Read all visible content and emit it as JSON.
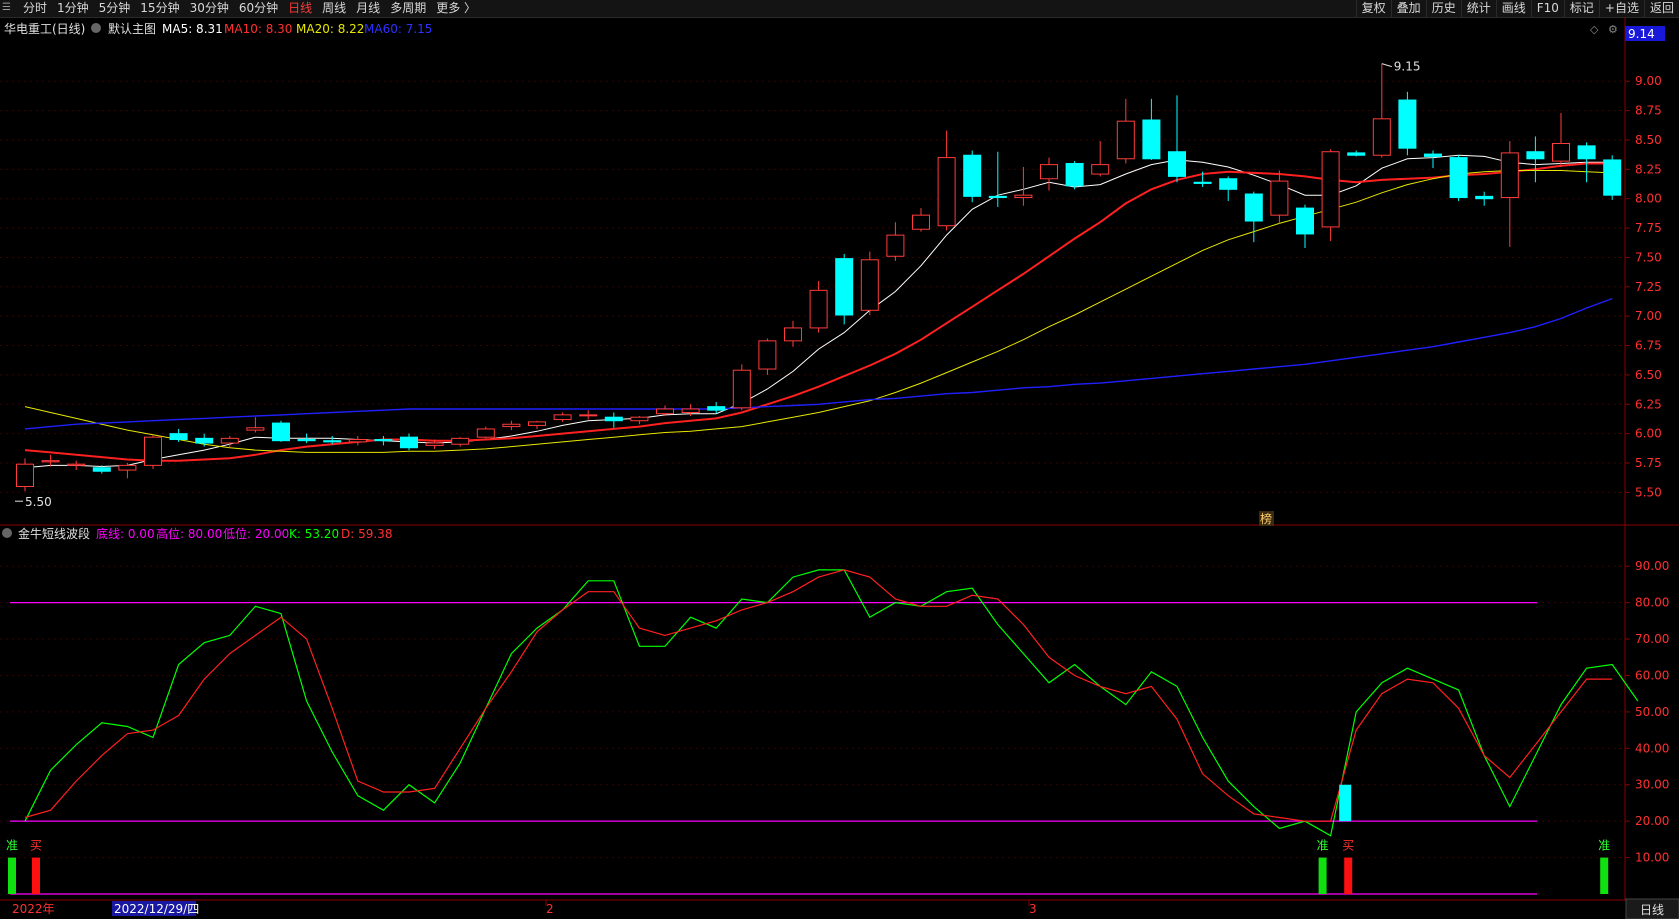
{
  "toolbar": {
    "left": [
      "分时",
      "1分钟",
      "5分钟",
      "15分钟",
      "30分钟",
      "60分钟",
      "日线",
      "周线",
      "月线",
      "多周期",
      "更多 〉"
    ],
    "active": "日线",
    "right": [
      "复权",
      "叠加",
      "历史",
      "统计",
      "画线",
      "F10",
      "标记",
      "+自选",
      "返回"
    ]
  },
  "main_header": {
    "stock": "华电重工(日线)",
    "template": "默认主图",
    "ma5": "MA5: 8.31",
    "ma10": "MA10: 8.30",
    "ma20": "MA20: 8.22",
    "ma60": "MA60: 7.15",
    "current_price_tag": "9.14",
    "high_label": "9.15",
    "low_label": "5.50",
    "badge": "榜"
  },
  "indicator_header": {
    "name": "金牛短线波段",
    "bottom": "底线: 0.00",
    "high": "高位: 80.00",
    "low": "低位: 20.00",
    "k": "K: 53.20",
    "d": "D: 59.38"
  },
  "signals": [
    "准",
    "买",
    "准",
    "买",
    "准"
  ],
  "xaxis": [
    "2022年",
    "2022/12/29/四",
    "2",
    "3"
  ],
  "period_tab": "日线",
  "colors": {
    "up": "#ff3b3b",
    "down": "#00ffff",
    "ma5": "#ffffff",
    "ma10": "#ff2020",
    "ma20": "#e8e800",
    "ma60": "#2020ff",
    "k": "#00ff00",
    "d": "#ff2020",
    "guide": "#ff00ff"
  },
  "chart_data": [
    {
      "type": "candlestick",
      "ylim": [
        5.35,
        9.3
      ],
      "yticks": [
        5.5,
        5.75,
        6.0,
        6.25,
        6.5,
        6.75,
        7.0,
        7.25,
        7.5,
        7.75,
        8.0,
        8.25,
        8.5,
        8.75,
        9.0
      ],
      "series": [
        {
          "name": "K线",
          "ohlc": [
            [
              5.55,
              5.79,
              5.51,
              5.74
            ],
            [
              5.76,
              5.82,
              5.72,
              5.77
            ],
            [
              5.73,
              5.77,
              5.69,
              5.74
            ],
            [
              5.71,
              5.73,
              5.66,
              5.68
            ],
            [
              5.69,
              5.75,
              5.62,
              5.73
            ],
            [
              5.73,
              5.99,
              5.7,
              5.97
            ],
            [
              6.0,
              6.04,
              5.93,
              5.95
            ],
            [
              5.96,
              6.0,
              5.89,
              5.92
            ],
            [
              5.92,
              5.98,
              5.88,
              5.96
            ],
            [
              6.03,
              6.14,
              6.01,
              6.05
            ],
            [
              6.09,
              6.11,
              5.93,
              5.94
            ],
            [
              5.95,
              6.0,
              5.92,
              5.94
            ],
            [
              5.94,
              5.98,
              5.91,
              5.93
            ],
            [
              5.93,
              5.98,
              5.9,
              5.95
            ],
            [
              5.95,
              5.98,
              5.9,
              5.94
            ],
            [
              5.97,
              6.0,
              5.86,
              5.88
            ],
            [
              5.9,
              5.95,
              5.87,
              5.92
            ],
            [
              5.91,
              5.97,
              5.89,
              5.96
            ],
            [
              5.97,
              6.06,
              5.96,
              6.04
            ],
            [
              6.06,
              6.11,
              6.03,
              6.08
            ],
            [
              6.07,
              6.11,
              6.04,
              6.1
            ],
            [
              6.12,
              6.18,
              6.1,
              6.16
            ],
            [
              6.16,
              6.2,
              6.12,
              6.16
            ],
            [
              6.14,
              6.18,
              6.05,
              6.11
            ],
            [
              6.11,
              6.15,
              6.08,
              6.14
            ],
            [
              6.17,
              6.24,
              6.15,
              6.21
            ],
            [
              6.18,
              6.25,
              6.15,
              6.21
            ],
            [
              6.23,
              6.27,
              6.17,
              6.2
            ],
            [
              6.22,
              6.59,
              6.2,
              6.54
            ],
            [
              6.55,
              6.81,
              6.5,
              6.79
            ],
            [
              6.79,
              6.96,
              6.74,
              6.9
            ],
            [
              6.9,
              7.3,
              6.86,
              7.22
            ],
            [
              7.49,
              7.53,
              6.93,
              7.01
            ],
            [
              7.05,
              7.55,
              7.01,
              7.48
            ],
            [
              7.51,
              7.8,
              7.47,
              7.69
            ],
            [
              7.74,
              7.92,
              7.72,
              7.86
            ],
            [
              7.77,
              8.58,
              7.73,
              8.35
            ],
            [
              8.37,
              8.41,
              7.97,
              8.02
            ],
            [
              8.02,
              8.4,
              7.93,
              8.01
            ],
            [
              8.01,
              8.27,
              7.94,
              8.03
            ],
            [
              8.17,
              8.35,
              8.07,
              8.29
            ],
            [
              8.3,
              8.32,
              8.08,
              8.11
            ],
            [
              8.21,
              8.49,
              8.19,
              8.29
            ],
            [
              8.34,
              8.85,
              8.3,
              8.66
            ],
            [
              8.67,
              8.85,
              8.33,
              8.34
            ],
            [
              8.4,
              8.88,
              8.14,
              8.19
            ],
            [
              8.14,
              8.23,
              8.1,
              8.13
            ],
            [
              8.17,
              8.19,
              7.98,
              8.08
            ],
            [
              8.04,
              8.06,
              7.63,
              7.81
            ],
            [
              7.86,
              8.24,
              7.79,
              8.15
            ],
            [
              7.92,
              7.95,
              7.58,
              7.7
            ],
            [
              7.76,
              8.42,
              7.64,
              8.4
            ],
            [
              8.39,
              8.41,
              8.36,
              8.37
            ],
            [
              8.37,
              9.15,
              8.35,
              8.68
            ],
            [
              8.84,
              8.91,
              8.37,
              8.43
            ],
            [
              8.38,
              8.41,
              8.26,
              8.36
            ],
            [
              8.35,
              8.37,
              7.98,
              8.01
            ],
            [
              8.02,
              8.06,
              7.94,
              8.0
            ],
            [
              8.01,
              8.49,
              7.59,
              8.39
            ],
            [
              8.4,
              8.53,
              8.14,
              8.34
            ],
            [
              8.32,
              8.73,
              8.27,
              8.47
            ],
            [
              8.45,
              8.48,
              8.14,
              8.34
            ],
            [
              8.33,
              8.37,
              7.99,
              8.03
            ]
          ]
        },
        {
          "name": "MA5",
          "values": [
            5.71,
            5.73,
            5.73,
            5.72,
            5.73,
            5.78,
            5.82,
            5.86,
            5.91,
            5.97,
            5.96,
            5.96,
            5.96,
            5.95,
            5.94,
            5.93,
            5.92,
            5.93,
            5.95,
            5.98,
            6.02,
            6.07,
            6.11,
            6.12,
            6.13,
            6.16,
            6.17,
            6.17,
            6.26,
            6.38,
            6.53,
            6.72,
            6.86,
            7.05,
            7.21,
            7.43,
            7.69,
            7.91,
            8.03,
            8.08,
            8.14,
            8.1,
            8.12,
            8.21,
            8.29,
            8.33,
            8.31,
            8.27,
            8.2,
            8.12,
            8.03,
            8.03,
            8.11,
            8.26,
            8.34,
            8.35,
            8.37,
            8.36,
            8.31,
            8.29,
            8.3,
            8.31,
            8.31
          ]
        },
        {
          "name": "MA10",
          "values": [
            5.86,
            5.84,
            5.82,
            5.8,
            5.78,
            5.77,
            5.77,
            5.78,
            5.79,
            5.82,
            5.86,
            5.89,
            5.91,
            5.93,
            5.95,
            5.95,
            5.94,
            5.94,
            5.95,
            5.96,
            5.98,
            6.0,
            6.02,
            6.04,
            6.06,
            6.09,
            6.11,
            6.13,
            6.18,
            6.25,
            6.32,
            6.4,
            6.49,
            6.58,
            6.68,
            6.8,
            6.94,
            7.08,
            7.22,
            7.36,
            7.51,
            7.66,
            7.8,
            7.96,
            8.08,
            8.16,
            8.21,
            8.23,
            8.22,
            8.21,
            8.19,
            8.16,
            8.14,
            8.16,
            8.17,
            8.18,
            8.2,
            8.21,
            8.23,
            8.25,
            8.28,
            8.3,
            8.3
          ]
        },
        {
          "name": "MA20",
          "values": [
            6.23,
            6.18,
            6.13,
            6.08,
            6.03,
            5.99,
            5.95,
            5.91,
            5.88,
            5.86,
            5.85,
            5.84,
            5.84,
            5.84,
            5.84,
            5.85,
            5.85,
            5.86,
            5.87,
            5.89,
            5.91,
            5.93,
            5.95,
            5.97,
            5.99,
            6.01,
            6.02,
            6.04,
            6.06,
            6.1,
            6.14,
            6.18,
            6.23,
            6.28,
            6.35,
            6.43,
            6.52,
            6.61,
            6.7,
            6.8,
            6.91,
            7.01,
            7.12,
            7.23,
            7.34,
            7.45,
            7.56,
            7.65,
            7.72,
            7.79,
            7.85,
            7.91,
            7.97,
            8.05,
            8.12,
            8.17,
            8.21,
            8.23,
            8.24,
            8.24,
            8.24,
            8.23,
            8.22
          ]
        },
        {
          "name": "MA60",
          "values": [
            6.04,
            6.06,
            6.08,
            6.09,
            6.1,
            6.11,
            6.12,
            6.13,
            6.14,
            6.15,
            6.16,
            6.17,
            6.18,
            6.19,
            6.2,
            6.21,
            6.21,
            6.21,
            6.21,
            6.21,
            6.21,
            6.21,
            6.21,
            6.21,
            6.21,
            6.21,
            6.21,
            6.21,
            6.22,
            6.23,
            6.24,
            6.25,
            6.27,
            6.29,
            6.3,
            6.32,
            6.34,
            6.35,
            6.37,
            6.39,
            6.4,
            6.42,
            6.43,
            6.45,
            6.47,
            6.49,
            6.51,
            6.53,
            6.55,
            6.57,
            6.59,
            6.62,
            6.65,
            6.68,
            6.71,
            6.74,
            6.78,
            6.82,
            6.86,
            6.91,
            6.98,
            7.07,
            7.15
          ]
        }
      ]
    },
    {
      "type": "line",
      "ylim": [
        0,
        95
      ],
      "yticks": [
        10,
        20,
        30,
        40,
        50,
        60,
        70,
        80,
        90
      ],
      "guides": [
        20,
        80,
        0
      ],
      "series": [
        {
          "name": "K",
          "values": [
            20,
            34,
            41,
            47,
            46,
            43,
            63,
            69,
            71,
            79,
            77,
            53,
            39,
            27,
            23,
            30,
            25,
            36,
            51,
            66,
            73,
            78,
            86,
            86,
            68,
            68,
            76,
            73,
            81,
            80,
            87,
            89,
            89,
            76,
            80,
            79,
            83,
            84,
            74,
            66,
            58,
            63,
            57,
            52,
            61,
            57,
            43,
            31,
            24,
            18,
            20,
            16,
            50,
            58,
            62,
            59,
            56,
            38,
            24,
            38,
            52,
            62,
            63,
            53
          ]
        },
        {
          "name": "D",
          "values": [
            21,
            23,
            31,
            38,
            44,
            45,
            49,
            59,
            66,
            71,
            76,
            70,
            51,
            31,
            28,
            28,
            29,
            40,
            51,
            61,
            72,
            78,
            83,
            83,
            73,
            71,
            73,
            75,
            78,
            80,
            83,
            87,
            89,
            87,
            81,
            79,
            79,
            82,
            81,
            74,
            65,
            60,
            57,
            55,
            57,
            48,
            33,
            27,
            22,
            21,
            20,
            20,
            45,
            55,
            59,
            58,
            51,
            38,
            32,
            41,
            50,
            59,
            59
          ]
        }
      ]
    }
  ]
}
